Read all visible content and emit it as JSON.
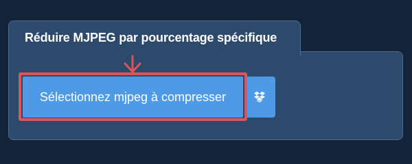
{
  "tab": {
    "title": "Réduire MJPEG par pourcentage spécifique"
  },
  "actions": {
    "select_file_label": "Sélectionnez mjpeg à compresser",
    "dropbox_icon": "dropbox-icon"
  },
  "colors": {
    "background": "#12233a",
    "panel": "#2d4a6c",
    "button": "#4f9ae6",
    "highlight": "#d9575a"
  }
}
